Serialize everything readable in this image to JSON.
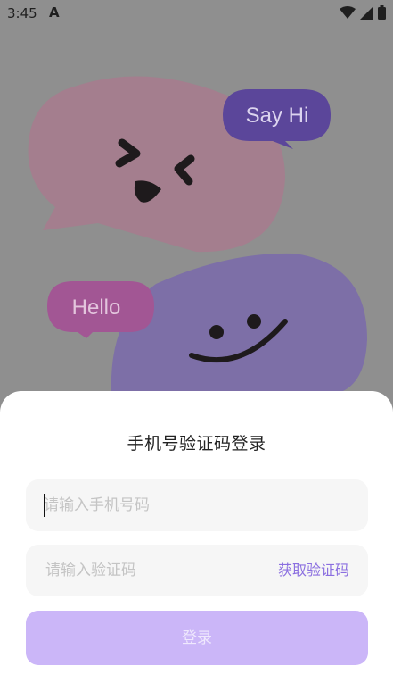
{
  "status_bar": {
    "time": "3:45",
    "app_indicator": "A",
    "icons": [
      "wifi-icon",
      "signal-icon",
      "battery-icon"
    ]
  },
  "illustration": {
    "bubble_top_text": "Say Hi",
    "bubble_bottom_text": "Hello"
  },
  "login": {
    "title": "手机号验证码登录",
    "phone_placeholder": "请输入手机号码",
    "phone_value": "",
    "code_placeholder": "请输入验证码",
    "code_value": "",
    "get_code_label": "获取验证码",
    "submit_label": "登录"
  },
  "colors": {
    "accent": "#8b6fe0",
    "button_disabled": "#cbb6f8",
    "overlay": "#8f8f8f"
  }
}
